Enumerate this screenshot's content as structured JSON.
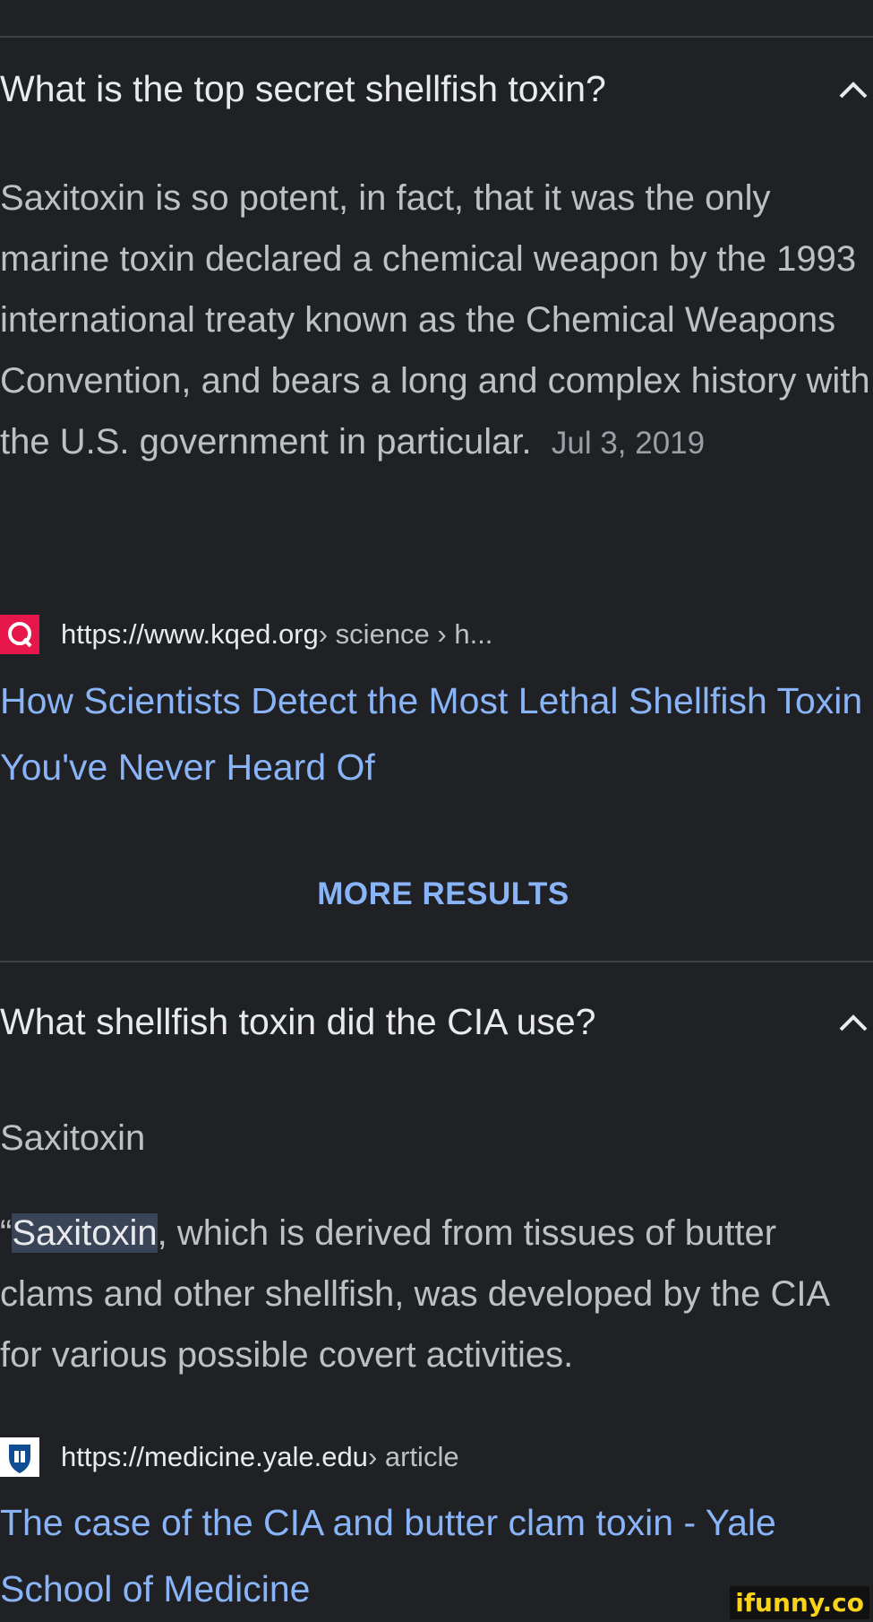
{
  "section1": {
    "question": "What is the top secret shellfish toxin?",
    "answer": "Saxitoxin is so potent, in fact, that it was the only marine toxin declared a chemical weapon by the 1993 international treaty known as the Chemical Weapons Convention, and bears a long and complex history with the U.S. government in particular.",
    "date": "Jul 3, 2019",
    "source_url": "https://www.kqed.org",
    "source_crumbs": " › science › h...",
    "source_icon": "kqed-q-icon",
    "link_title": "How Scientists Detect the Most Lethal Shellfish Toxin You've Never Heard Of"
  },
  "more_results": "MORE RESULTS",
  "section2": {
    "question": "What shellfish toxin did the CIA use?",
    "answer_title": "Saxitoxin",
    "quote_open": "“",
    "answer_highlight": "Saxitoxin",
    "answer_rest": ", which is derived from tissues of butter clams and other shellfish, was developed by the CIA for various possible covert activities.",
    "source_url": "https://medicine.yale.edu",
    "source_crumbs": " › article",
    "source_icon": "yale-shield-icon",
    "link_title": "The case of the CIA and butter clam toxin - Yale School of Medicine"
  },
  "watermark": "ifunny.co",
  "colors": {
    "background": "#202124",
    "link": "#8ab4f8",
    "text": "#e8eaed",
    "muted": "#bdc1c6",
    "kqed_red": "#e8174b",
    "yale_blue": "#0f4d92"
  }
}
